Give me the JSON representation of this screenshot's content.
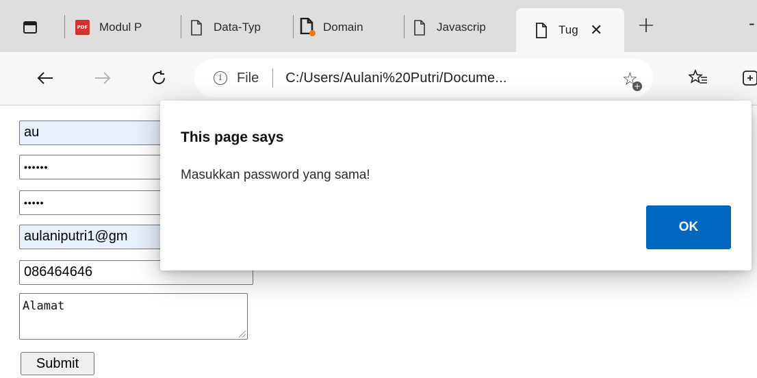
{
  "browser": {
    "tabs": [
      {
        "label": "Modul P",
        "icon": "pdf-icon",
        "active": false
      },
      {
        "label": "Data-Typ",
        "icon": "page-icon",
        "active": false
      },
      {
        "label": "Domain",
        "icon": "page-loading-icon",
        "active": false
      },
      {
        "label": "Javascrip",
        "icon": "page-icon",
        "active": false
      },
      {
        "label": "Tug",
        "icon": "page-icon",
        "active": true
      }
    ],
    "pdf_badge": "PDF",
    "new_tab_symbol": "+",
    "close_symbol": "✕",
    "address": {
      "scheme_label": "File",
      "url": "C:/Users/Aulani%20Putri/Docume..."
    }
  },
  "form": {
    "username": "au",
    "password": "••••••",
    "confirm_password": "•••••",
    "email": "aulaniputri1@gm",
    "phone": "086464646",
    "address": "Alamat",
    "submit_label": "Submit"
  },
  "dialog": {
    "title": "This page says",
    "message": "Masukkan password yang sama!",
    "ok_label": "OK"
  },
  "colors": {
    "accent": "#0067c0",
    "autofill": "#e8f0fe",
    "tabstrip": "#dedede",
    "loading": "#f0780a",
    "pdf": "#d23131"
  }
}
